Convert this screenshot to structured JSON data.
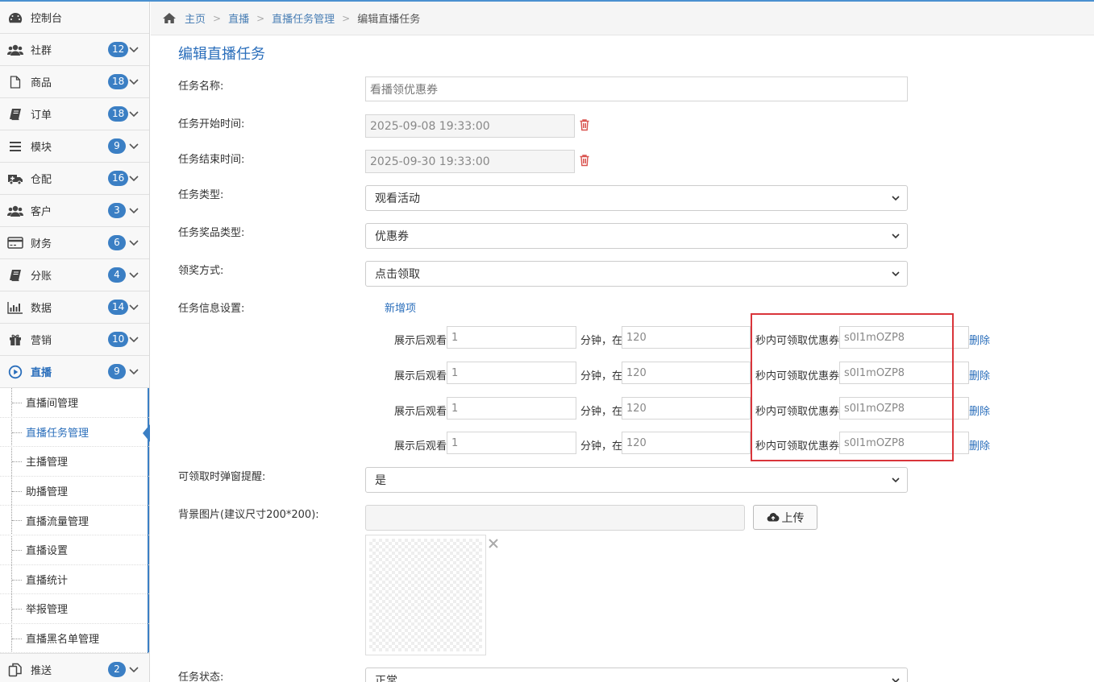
{
  "sidebar": {
    "items": [
      {
        "label": "控制台",
        "icon": "dashboard-icon"
      },
      {
        "label": "社群",
        "icon": "users-icon",
        "badge": "12"
      },
      {
        "label": "商品",
        "icon": "file-icon",
        "badge": "18"
      },
      {
        "label": "订单",
        "icon": "book-icon",
        "badge": "18"
      },
      {
        "label": "模块",
        "icon": "list-icon",
        "badge": "9"
      },
      {
        "label": "仓配",
        "icon": "ambulance-icon",
        "badge": "16"
      },
      {
        "label": "客户",
        "icon": "users-icon",
        "badge": "3"
      },
      {
        "label": "财务",
        "icon": "credit-card-icon",
        "badge": "6"
      },
      {
        "label": "分账",
        "icon": "book-icon",
        "badge": "4"
      },
      {
        "label": "数据",
        "icon": "bar-chart-icon",
        "badge": "14"
      },
      {
        "label": "营销",
        "icon": "gift-icon",
        "badge": "10"
      },
      {
        "label": "直播",
        "icon": "play-circle-icon",
        "badge": "9"
      }
    ],
    "sub_items": [
      "直播间管理",
      "直播任务管理",
      "主播管理",
      "助播管理",
      "直播流量管理",
      "直播设置",
      "直播统计",
      "举报管理",
      "直播黑名单管理"
    ],
    "bottom_item": {
      "label": "推送",
      "icon": "copy-icon",
      "badge": "2"
    }
  },
  "breadcrumb": {
    "home": "主页",
    "live": "直播",
    "task_mgmt": "直播任务管理",
    "current": "编辑直播任务"
  },
  "page_title": "编辑直播任务",
  "form": {
    "name_label": "任务名称:",
    "name_placeholder": "看播领优惠券",
    "start_label": "任务开始时间:",
    "start_value": "2025-09-08 19:33:00",
    "end_label": "任务结束时间:",
    "end_value": "2025-09-30 19:33:00",
    "type_label": "任务类型:",
    "type_value": "观看活动",
    "prize_label": "任务奖品类型:",
    "prize_value": "优惠券",
    "claim_label": "领奖方式:",
    "claim_value": "点击领取",
    "info_label": "任务信息设置:",
    "add_item": "新增项",
    "info_rows": [
      {
        "prefix": "展示后观看",
        "minutes": "1",
        "mid": "分钟，在",
        "seconds": "120",
        "suffix": "秒内可领取优惠券",
        "coupon": "s0I1mOZP8",
        "delete": "删除"
      },
      {
        "prefix": "展示后观看",
        "minutes": "1",
        "mid": "分钟，在",
        "seconds": "120",
        "suffix": "秒内可领取优惠券",
        "coupon": "s0I1mOZP8",
        "delete": "删除"
      },
      {
        "prefix": "展示后观看",
        "minutes": "1",
        "mid": "分钟，在",
        "seconds": "120",
        "suffix": "秒内可领取优惠券",
        "coupon": "s0I1mOZP8",
        "delete": "删除"
      },
      {
        "prefix": "展示后观看",
        "minutes": "1",
        "mid": "分钟，在",
        "seconds": "120",
        "suffix": "秒内可领取优惠券",
        "coupon": "s0I1mOZP8",
        "delete": "删除"
      }
    ],
    "popup_label": "可领取时弹窗提醒:",
    "popup_value": "是",
    "bg_label": "背景图片(建议尺寸200*200):",
    "upload": "上传",
    "status_label": "任务状态:",
    "status_value": "正常"
  },
  "colors": {
    "accent": "#2a6ebb",
    "badge": "#3b7fc4",
    "highlight": "#d9343a",
    "trash": "#d9534f"
  }
}
